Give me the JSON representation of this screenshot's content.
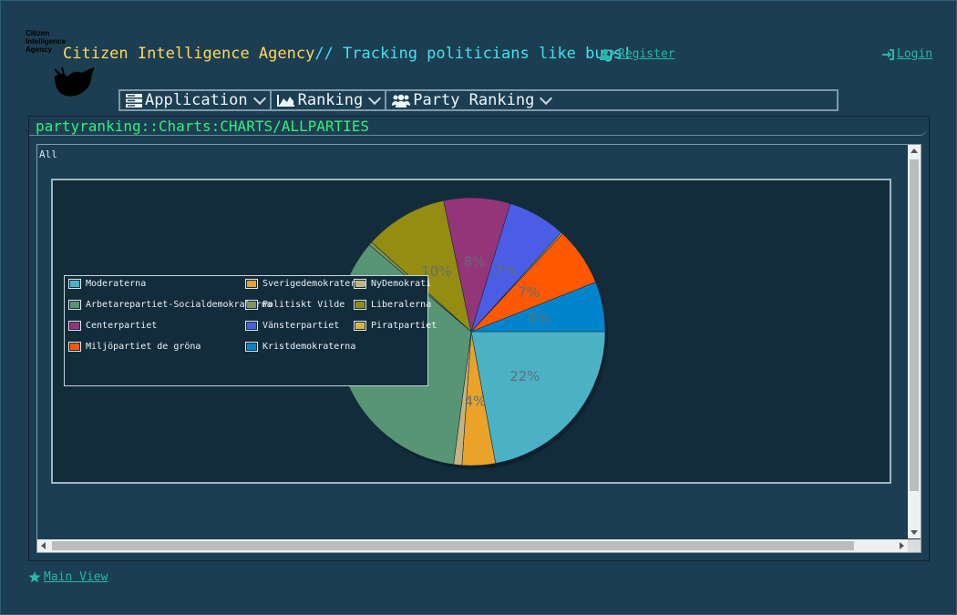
{
  "header": {
    "logo_text": [
      "Citizen",
      "Intelligence",
      "Agency"
    ],
    "org_name": "Citizen Intelligence Agency",
    "tagline": "// Tracking politicians like bugs!",
    "register_label": "Register",
    "login_label": "Login"
  },
  "menu": {
    "items": [
      {
        "label": "Application",
        "icon": "server-icon"
      },
      {
        "label": "Ranking",
        "icon": "area-chart-icon"
      },
      {
        "label": "Party Ranking",
        "icon": "users-icon"
      }
    ]
  },
  "panel": {
    "title": "partyranking::Charts:CHARTS/ALLPARTIES",
    "section_label": "All"
  },
  "chart_data": {
    "type": "pie",
    "title": "",
    "legend_position": "left-middle overlay",
    "slices": [
      {
        "name": "Moderaterna",
        "value": 22,
        "color": "#4bb2c5",
        "label": "22%"
      },
      {
        "name": "Sverigedemokraterna",
        "value": 4,
        "color": "#eaa228",
        "label": "4%"
      },
      {
        "name": "NyDemokrati",
        "value": 1,
        "color": "#c5b47f",
        "label": ""
      },
      {
        "name": "Arbetarepartiet-Socialdemokraterna",
        "value": 34,
        "color": "#579575",
        "label": ""
      },
      {
        "name": "Politiskt Vilde",
        "value": 0.4,
        "color": "#839557",
        "label": ""
      },
      {
        "name": "Liberalerna",
        "value": 10,
        "color": "#958c12",
        "label": "10%"
      },
      {
        "name": "Centerpartiet",
        "value": 8,
        "color": "#953579",
        "label": "8%"
      },
      {
        "name": "Vänsterpartiet",
        "value": 7,
        "color": "#4b5de4",
        "label": "7%"
      },
      {
        "name": "Piratpartiet",
        "value": 0.2,
        "color": "#d8b83f",
        "label": ""
      },
      {
        "name": "Miljöpartiet de gröna",
        "value": 7,
        "color": "#ff5800",
        "label": "7%"
      },
      {
        "name": "Kristdemokraterna",
        "value": 6,
        "color": "#0085cc",
        "label": "6%"
      }
    ]
  },
  "footer": {
    "main_view_label": "Main View"
  },
  "colors": {
    "background": "#1c3e52",
    "title_org": "#ffd85a",
    "title_tagline": "#41e2ee",
    "link": "#26b8a4",
    "panel_title": "#2ff07a"
  }
}
